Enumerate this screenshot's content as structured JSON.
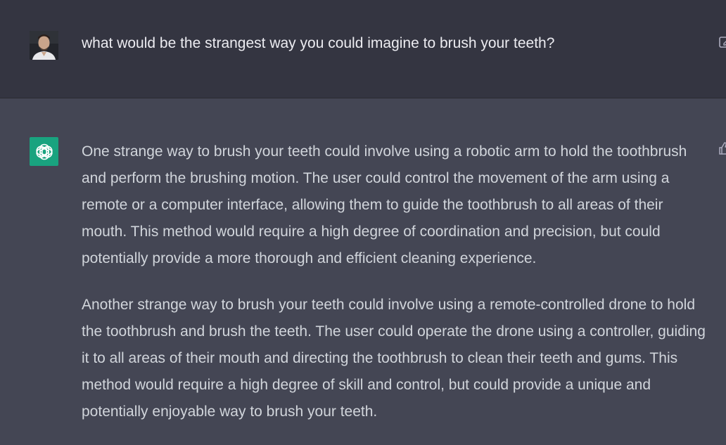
{
  "conversation": {
    "user_message": {
      "text": "what would be the strangest way you could imagine to brush your teeth?",
      "avatar_icon": "user-photo-avatar",
      "action_icon": "edit-icon"
    },
    "assistant_message": {
      "avatar_icon": "openai-logo-icon",
      "action_icon": "thumbs-up-icon",
      "paragraphs": [
        "One strange way to brush your teeth could involve using a robotic arm to hold the toothbrush and perform the brushing motion. The user could control the movement of the arm using a remote or a computer interface, allowing them to guide the toothbrush to all areas of their mouth. This method would require a high degree of coordination and precision, but could potentially provide a more thorough and efficient cleaning experience.",
        "Another strange way to brush your teeth could involve using a remote-controlled drone to hold the toothbrush and brush the teeth. The user could operate the drone using a controller, guiding it to all areas of their mouth and directing the toothbrush to clean their teeth and gums. This method would require a high degree of skill and control, but could provide a unique and potentially enjoyable way to brush your teeth."
      ]
    }
  },
  "colors": {
    "user_bg": "#343541",
    "assistant_bg": "#444654",
    "assistant_avatar": "#19a37f",
    "user_text": "#ececf1",
    "assistant_text": "#d1d5db"
  }
}
